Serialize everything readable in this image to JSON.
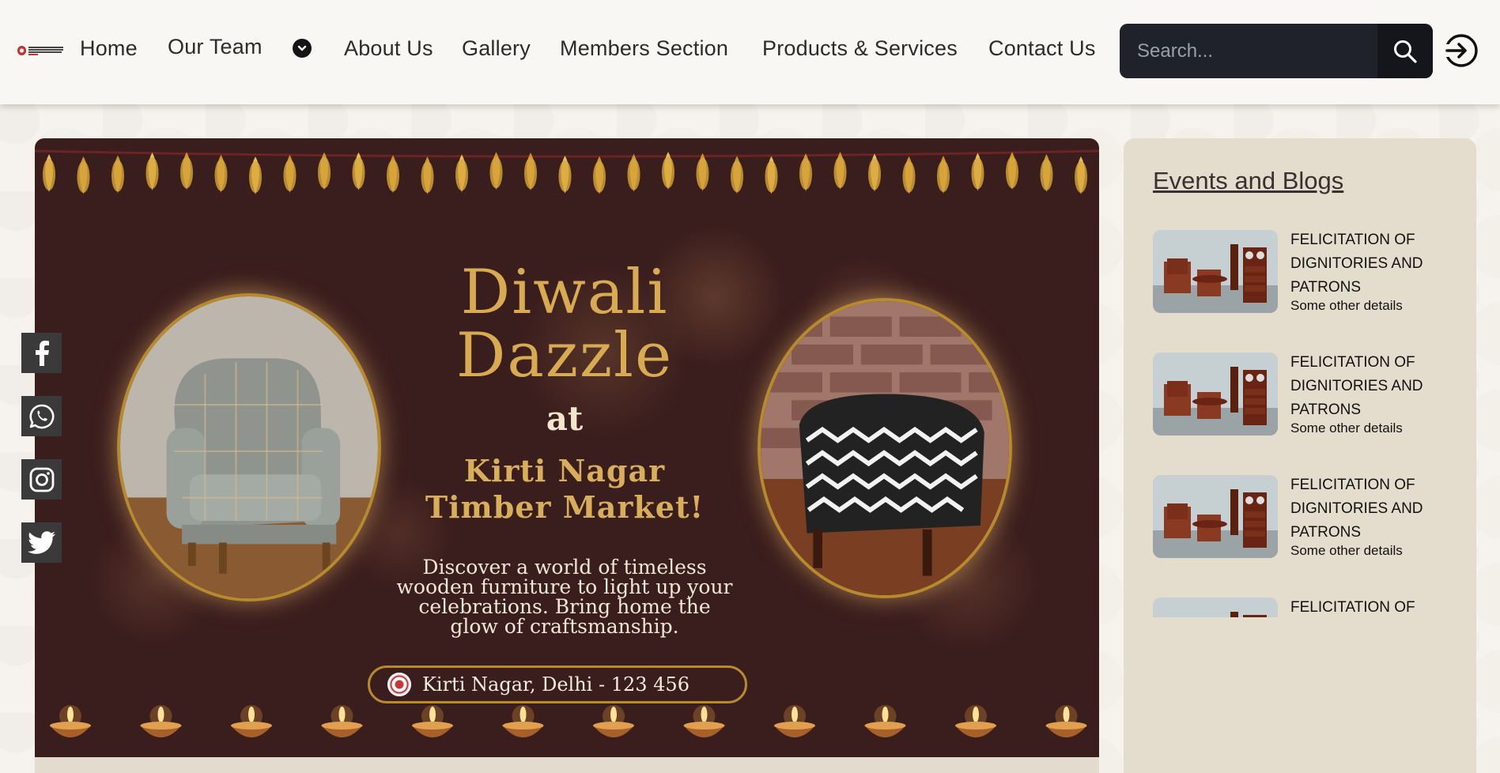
{
  "header": {
    "logo_alt": "logo",
    "nav": [
      {
        "label": "Home"
      },
      {
        "label": "Our Team"
      },
      {
        "label": "About Us"
      },
      {
        "label": "Gallery"
      },
      {
        "label": "Members Section"
      },
      {
        "label": "Products & Services"
      },
      {
        "label": "Contact Us"
      }
    ],
    "search": {
      "placeholder": "Search..."
    }
  },
  "social": [
    "facebook-icon",
    "whatsapp-icon",
    "instagram-icon",
    "twitter-icon"
  ],
  "banner": {
    "title_line1": "Diwali",
    "title_line2": "Dazzle",
    "at": "at",
    "sub_line1": "Kirti Nagar",
    "sub_line2": "Timber Market!",
    "desc_line1": "Discover a world of timeless",
    "desc_line2": "wooden furniture to light up your",
    "desc_line3": "celebrations. Bring home the",
    "desc_line4": "glow of craftsmanship.",
    "address": "Kirti Nagar, Delhi - 123 456"
  },
  "events": {
    "heading": "Events and Blogs",
    "items": [
      {
        "title": "FELICITATION OF DIGNITORIES AND PATRONS",
        "details": "Some other details"
      },
      {
        "title": "FELICITATION OF DIGNITORIES AND PATRONS",
        "details": "Some other details"
      },
      {
        "title": "FELICITATION OF DIGNITORIES AND PATRONS",
        "details": "Some other details"
      },
      {
        "title": "FELICITATION OF",
        "details": ""
      }
    ]
  },
  "colors": {
    "header_bg": "#f8f7f3",
    "banner_bg": "#3a1d1d",
    "gold": "#d8ab52",
    "search_bg": "#1f222a",
    "events_bg": "#e4ddce"
  }
}
